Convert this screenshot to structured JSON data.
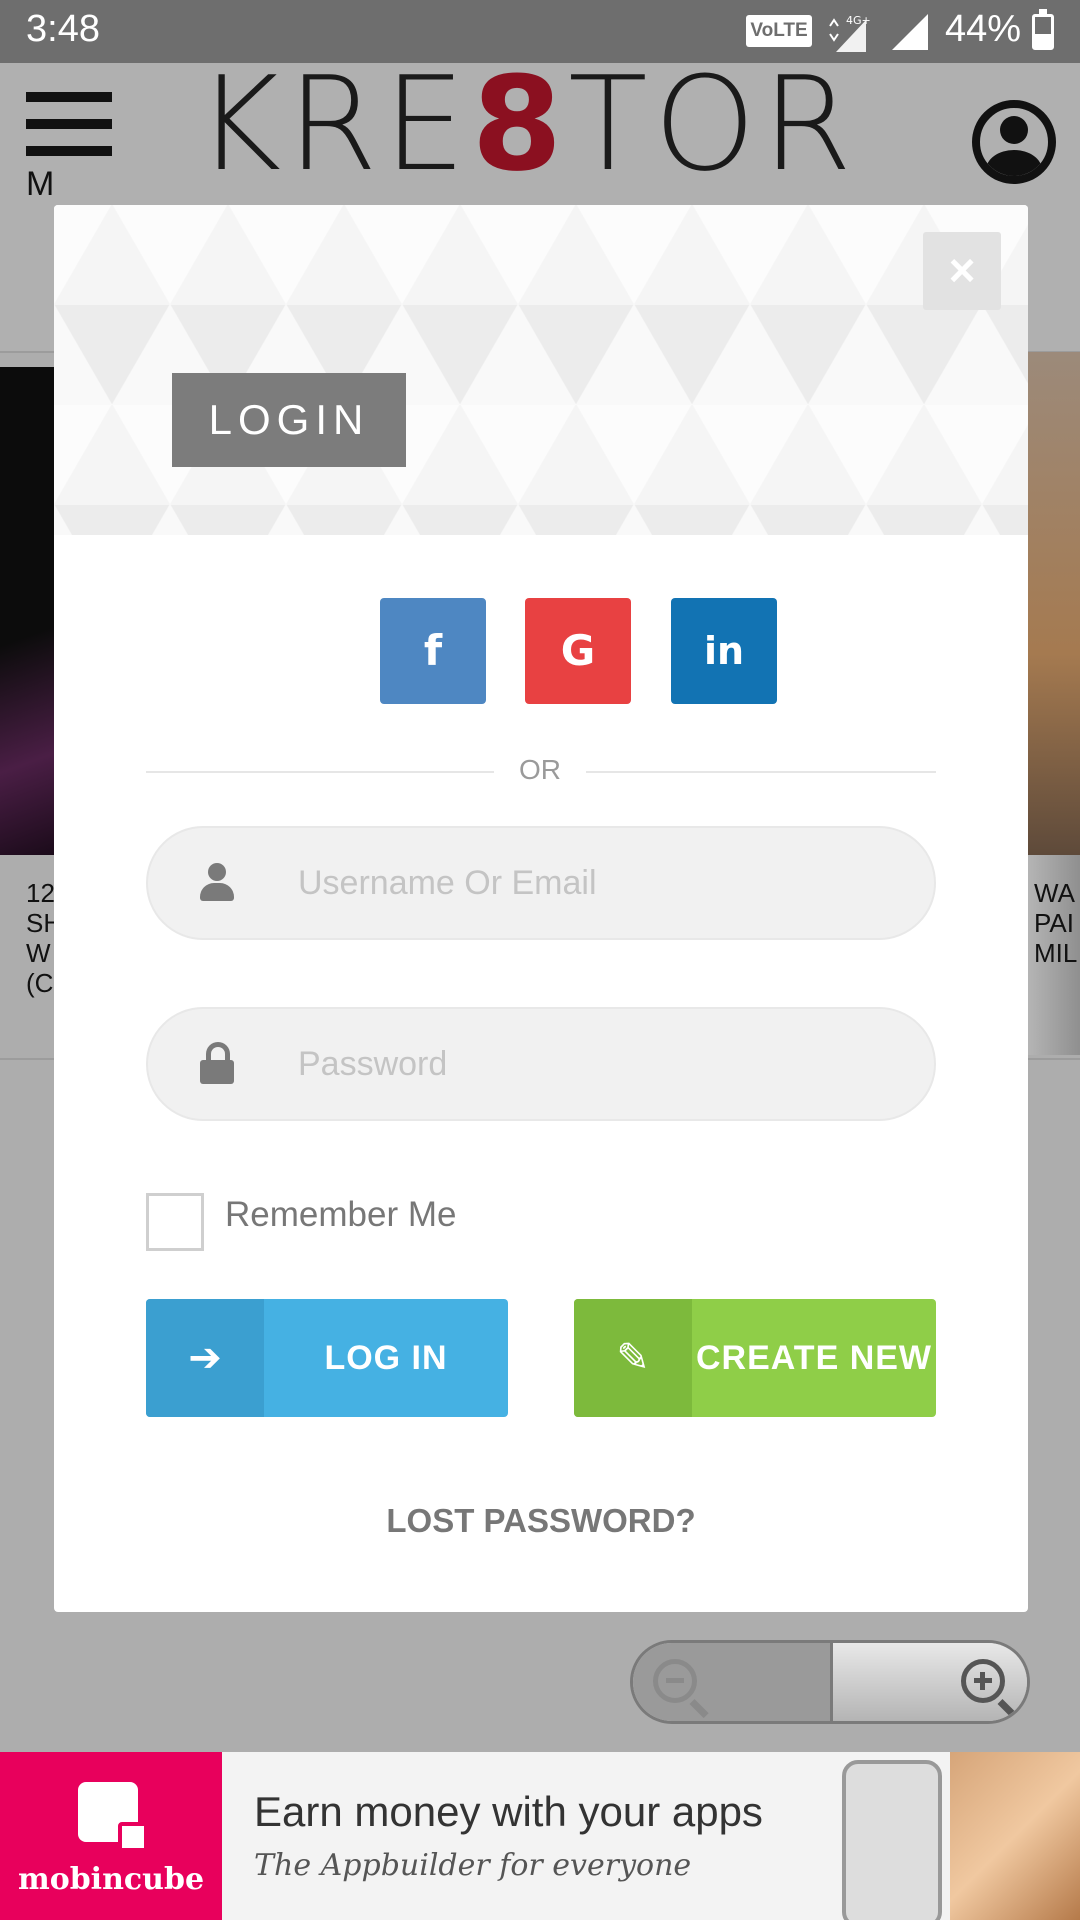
{
  "status_bar": {
    "time": "3:48",
    "volte": "VoLTE",
    "network": "4G+",
    "battery_percent": "44%",
    "battery_level": 0.44
  },
  "site": {
    "logo_prefix": "KRE",
    "logo_eight": "8",
    "logo_suffix": "TOR",
    "menu_letter": "M",
    "card_left_text": [
      "12",
      "SH",
      "W",
      "(C"
    ],
    "card_right_text": [
      "WA",
      "PAI",
      "MIL"
    ]
  },
  "modal": {
    "close_label": "×",
    "header_tag": "LOGIN",
    "social": {
      "facebook": "f",
      "google": "G",
      "linkedin": "in"
    },
    "or_text": "OR",
    "username_placeholder": "Username Or Email",
    "password_placeholder": "Password",
    "remember_label": "Remember Me",
    "login_button": "LOG IN",
    "create_button": "CREATE NEW",
    "lost_password": "LOST PASSWORD?"
  },
  "ad": {
    "brand": "mobincube",
    "title": "Earn money with your apps",
    "subtitle": "The Appbuilder for everyone"
  },
  "colors": {
    "facebook": "#4e87c2",
    "google": "#e84142",
    "linkedin": "#1273b3",
    "login_button": "#45b1e3",
    "create_button": "#8fce48",
    "ad_brand": "#e8005c"
  },
  "icons": {
    "login_button_icon": "sign-in-icon",
    "create_button_icon": "pencil-icon",
    "username_icon": "person-icon",
    "password_icon": "lock-icon",
    "zoom_out": "zoom-out-icon",
    "zoom_in": "zoom-in-icon"
  }
}
